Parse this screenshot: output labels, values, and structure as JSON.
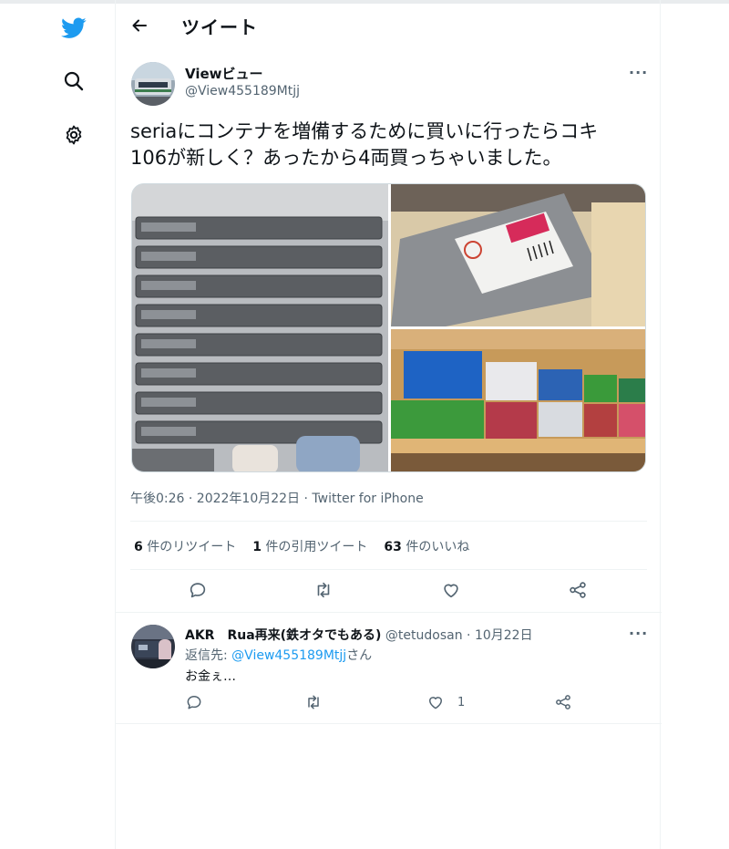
{
  "header": {
    "title": "ツイート"
  },
  "tweet": {
    "author_name": "Viewビュー",
    "author_handle": "@View455189Mtjj",
    "text_line1": "seriaにコンテナを増備するために買いに行ったらコキ",
    "text_line2": "106が新しく？あったから4両買っちゃいました。",
    "meta": "午後0:26 · 2022年10月22日 · Twitter for iPhone",
    "stats": [
      {
        "count": "6",
        "label": " 件のリツイート"
      },
      {
        "count": "1",
        "label": " 件の引用ツイート"
      },
      {
        "count": "63",
        "label": " 件のいいね"
      }
    ]
  },
  "reply": {
    "author_name": "AKR　Rua再来(鉄オタでもある)",
    "author_handle": " @tetudosan",
    "date": " · 10月22日",
    "reply_to_prefix": "返信先: ",
    "reply_to_handle": "@View455189Mtjj",
    "reply_to_suffix": "さん",
    "text": "お金ぇ…",
    "like_count": "1"
  },
  "colors": {
    "twitter_blue": "#1d9bf0",
    "secondary_text": "#536471",
    "border": "#eff3f4"
  },
  "icons": [
    "twitter-bird-icon",
    "search-icon",
    "settings-gear-icon",
    "back-arrow-icon",
    "more-icon",
    "reply-icon",
    "retweet-icon",
    "like-icon",
    "share-icon"
  ]
}
